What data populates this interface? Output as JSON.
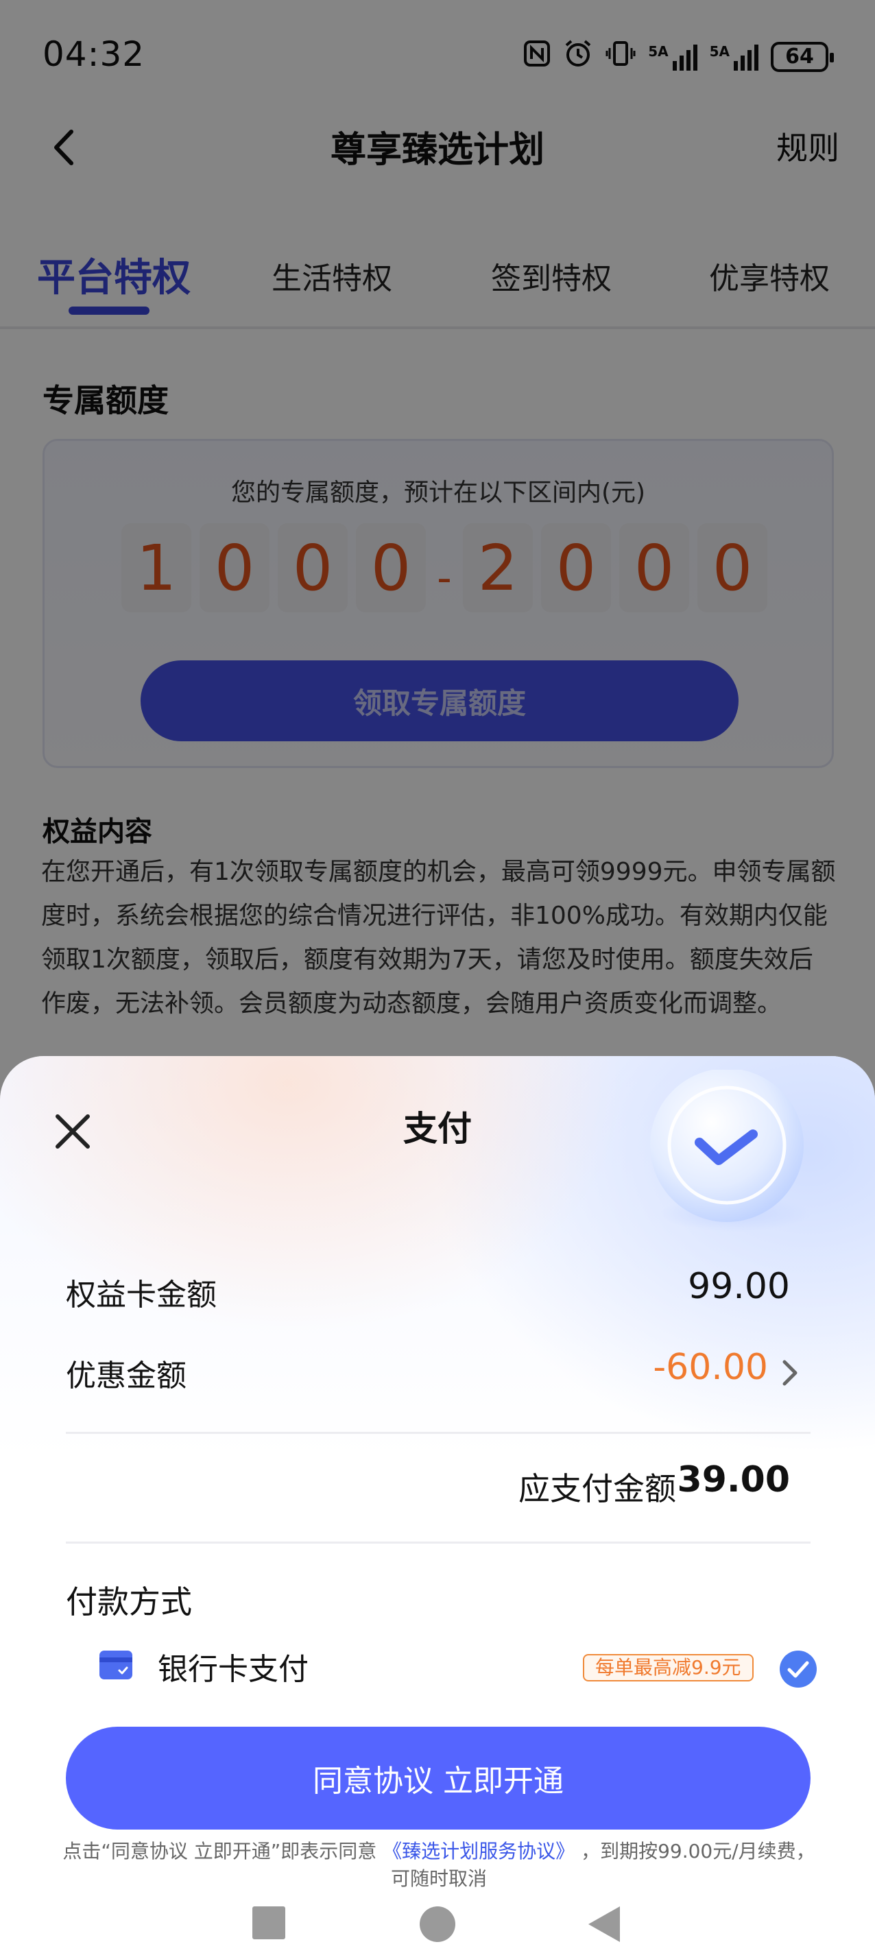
{
  "status_bar": {
    "time": "04:32",
    "network_1": "5A",
    "network_2": "5A",
    "battery": "64"
  },
  "nav": {
    "title": "尊享臻选计划",
    "rules": "规则"
  },
  "tabs": [
    {
      "label": "平台特权",
      "active": true
    },
    {
      "label": "生活特权",
      "active": false
    },
    {
      "label": "签到特权",
      "active": false
    },
    {
      "label": "优享特权",
      "active": false
    }
  ],
  "quota": {
    "section_title": "专属额度",
    "caption": "您的专属额度，预计在以下区间内(元)",
    "low_digits": [
      "1",
      "0",
      "0",
      "0"
    ],
    "high_digits": [
      "2",
      "0",
      "0",
      "0"
    ],
    "separator": "-",
    "button": "领取专属额度"
  },
  "rights": {
    "title": "权益内容",
    "body": "在您开通后，有1次领取专属额度的机会，最高可领9999元。申领专属额度时，系统会根据您的综合情况进行评估，非100%成功。有效期内仅能领取1次额度，领取后，额度有效期为7天，请您及时使用。额度失效后作废，无法补领。会员额度为动态额度，会随用户资质变化而调整。"
  },
  "payment_sheet": {
    "title": "支付",
    "card_amount_label": "权益卡金额",
    "card_amount_value": "99.00",
    "discount_label": "优惠金额",
    "discount_value": "-60.00",
    "due_label": "应支付金额",
    "due_value": "39.00",
    "method_title": "付款方式",
    "method_name": "银行卡支付",
    "promo_tag": "每单最高减9.9元",
    "confirm_button": "同意协议 立即开通",
    "agreement_prefix": "点击“同意协议 立即开通”即表示同意",
    "agreement_link": "《臻选计划服务协议》",
    "agreement_suffix": "，到期按99.00元/月续费，可随时取消"
  },
  "colors": {
    "accent": "#3b46d8",
    "primary_button": "#5565ff",
    "digit": "#e0541d",
    "discount": "#f07a2e"
  },
  "icons": [
    "back-arrow-icon",
    "close-icon",
    "check-badge-icon",
    "chevron-right-icon",
    "bank-card-icon",
    "checkmark-circle-icon",
    "recent-apps-icon",
    "home-icon",
    "back-triangle-icon"
  ]
}
